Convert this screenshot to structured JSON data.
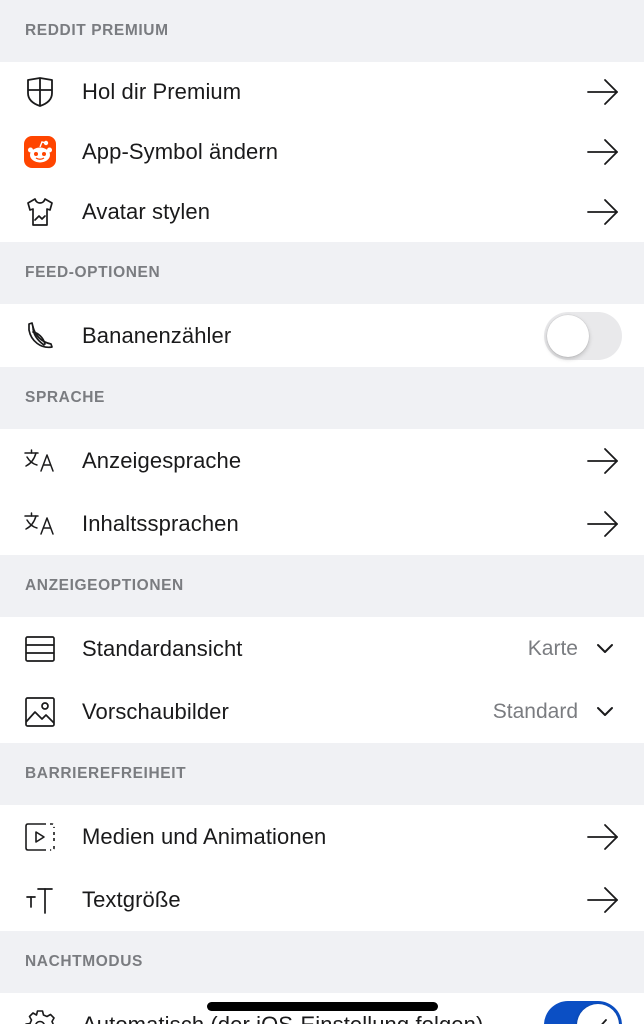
{
  "sections": {
    "premium": {
      "header": "REDDIT PREMIUM",
      "items": [
        {
          "label": "Hol dir Premium",
          "icon": "shield-icon",
          "action": "arrow"
        },
        {
          "label": "App-Symbol ändern",
          "icon": "app-icon",
          "action": "arrow"
        },
        {
          "label": "Avatar stylen",
          "icon": "shirt-icon",
          "action": "arrow"
        }
      ]
    },
    "feed": {
      "header": "FEED-OPTIONEN",
      "items": [
        {
          "label": "Bananenzähler",
          "icon": "banana-icon",
          "action": "toggle",
          "toggle_on": false
        }
      ]
    },
    "language": {
      "header": "SPRACHE",
      "items": [
        {
          "label": "Anzeigesprache",
          "icon": "translate-icon",
          "action": "arrow"
        },
        {
          "label": "Inhaltssprachen",
          "icon": "translate-icon",
          "action": "arrow"
        }
      ]
    },
    "display": {
      "header": "ANZEIGEOPTIONEN",
      "items": [
        {
          "label": "Standardansicht",
          "icon": "card-view-icon",
          "action": "select",
          "value": "Karte"
        },
        {
          "label": "Vorschaubilder",
          "icon": "image-icon",
          "action": "select",
          "value": "Standard"
        }
      ]
    },
    "accessibility": {
      "header": "BARRIEREFREIHEIT",
      "items": [
        {
          "label": "Medien und Animationen",
          "icon": "media-play-icon",
          "action": "arrow"
        },
        {
          "label": "Textgröße",
          "icon": "text-size-icon",
          "action": "arrow"
        }
      ]
    },
    "night": {
      "header": "NACHTMODUS",
      "items": [
        {
          "label": "Automatisch (der iOS-Einstellung folgen)",
          "icon": "gear-icon",
          "action": "toggle",
          "toggle_on": true
        }
      ]
    }
  },
  "colors": {
    "background": "#f0f1f4",
    "header_text": "#7a7c80",
    "label_text": "#1a1a1b",
    "toggle_on": "#0b4fc4",
    "toggle_off": "#e9e9eb",
    "reddit_orange": "#ff4500"
  }
}
